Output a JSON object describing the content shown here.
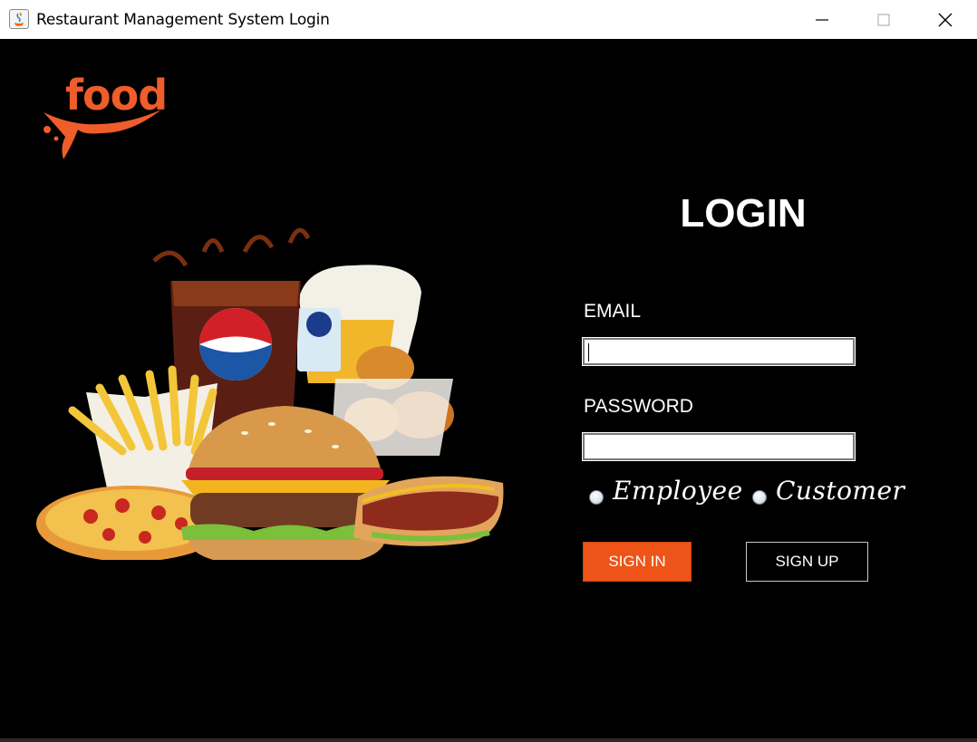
{
  "window": {
    "title": "Restaurant Management System Login",
    "controls": [
      "minimize-icon",
      "maximize-icon",
      "close-icon"
    ]
  },
  "logo": {
    "text": "food",
    "color": "#ee5d2a"
  },
  "login": {
    "heading": "LOGIN",
    "email_label": "EMAIL",
    "email_value": "",
    "password_label": "PASSWORD",
    "password_value": "",
    "role_options": [
      {
        "label": "Employee",
        "selected": false
      },
      {
        "label": "Customer",
        "selected": false
      }
    ],
    "sign_in_label": "SIGN IN",
    "sign_up_label": "SIGN UP"
  },
  "colors": {
    "background": "#000000",
    "accent": "#ee5317",
    "text": "#ffffff"
  }
}
